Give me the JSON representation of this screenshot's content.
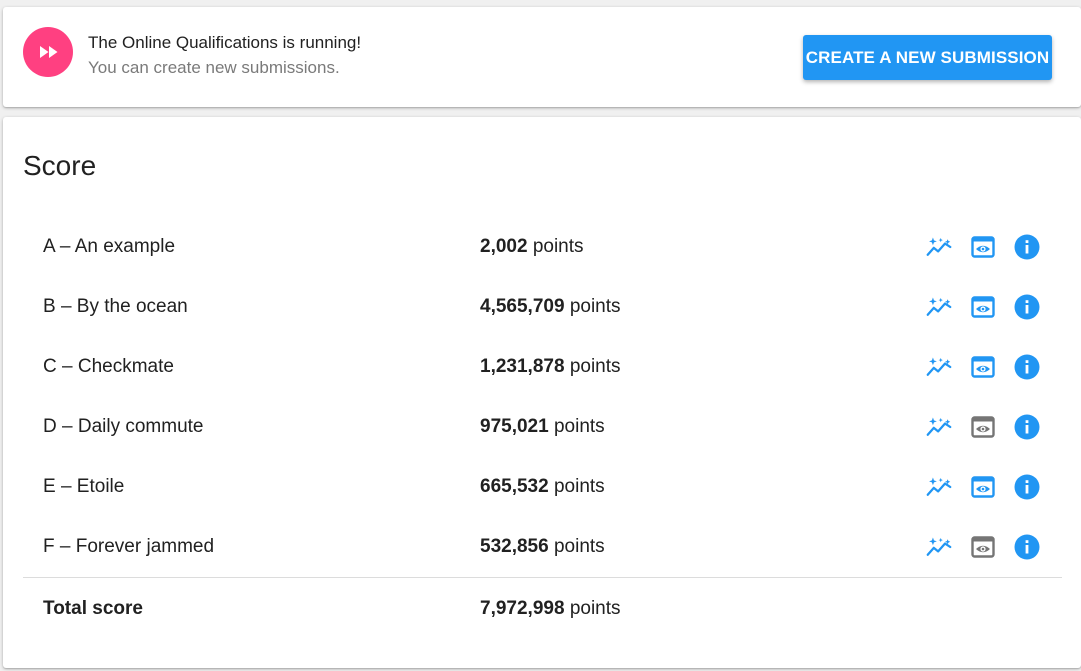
{
  "colors": {
    "accent": "#2196f3",
    "brand_pink": "#ff4081",
    "disabled_icon": "#757575"
  },
  "banner": {
    "icon": "fast-forward-icon",
    "title": "The Online Qualifications is running!",
    "subtitle": "You can create new submissions.",
    "button_label": "CREATE A NEW SUBMISSION"
  },
  "score": {
    "title": "Score",
    "unit": "points",
    "rows": [
      {
        "name": "A – An example",
        "points": "2,002",
        "preview_enabled": true
      },
      {
        "name": "B – By the ocean",
        "points": "4,565,709",
        "preview_enabled": true
      },
      {
        "name": "C – Checkmate",
        "points": "1,231,878",
        "preview_enabled": true
      },
      {
        "name": "D – Daily commute",
        "points": "975,021",
        "preview_enabled": false
      },
      {
        "name": "E – Etoile",
        "points": "665,532",
        "preview_enabled": true
      },
      {
        "name": "F – Forever jammed",
        "points": "532,856",
        "preview_enabled": false
      }
    ],
    "row_icons": [
      "auto-graph-icon",
      "preview-icon",
      "info-icon"
    ],
    "total_label": "Total score",
    "total_points": "7,972,998"
  }
}
